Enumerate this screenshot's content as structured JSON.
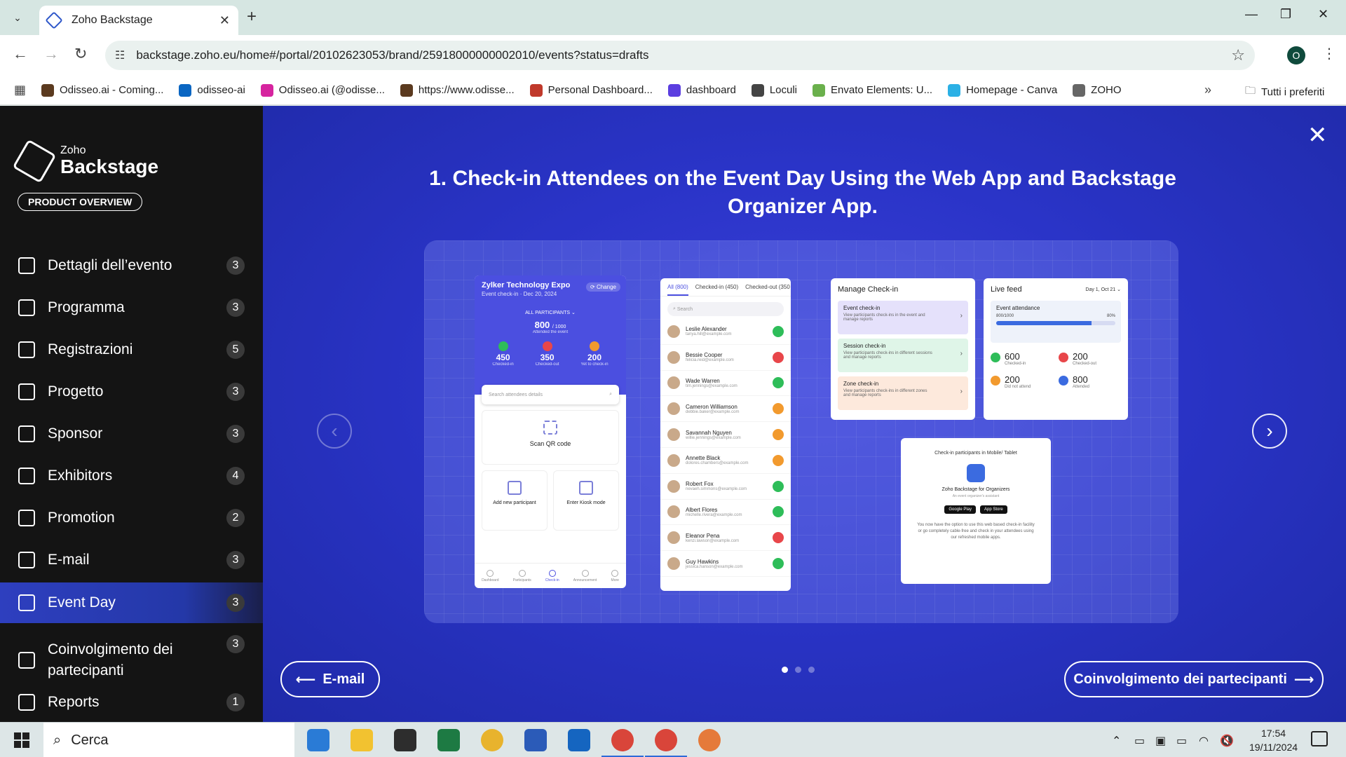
{
  "browser": {
    "tab_title": "Zoho Backstage",
    "url": "backstage.zoho.eu/home#/portal/20102623053/brand/25918000000002010/events?status=drafts",
    "profile_initial": "O",
    "bookmarks": [
      {
        "label": "Odisseo.ai - Coming...",
        "color": "#5b3a1f"
      },
      {
        "label": "odisseo-ai",
        "color": "#0a66c2"
      },
      {
        "label": "Odisseo.ai (@odisse...",
        "color": "#d6249f"
      },
      {
        "label": "https://www.odisse...",
        "color": "#5b3a1f"
      },
      {
        "label": "Personal Dashboard...",
        "color": "#c0392b"
      },
      {
        "label": "dashboard",
        "color": "#5b3ee0"
      },
      {
        "label": "Loculi",
        "color": "#444444"
      },
      {
        "label": "Envato Elements: U...",
        "color": "#6ab04c"
      },
      {
        "label": "Homepage - Canva",
        "color": "#2bb0e5"
      },
      {
        "label": "ZOHO",
        "color": "#666666"
      }
    ],
    "all_bookmarks": "Tutti i preferiti"
  },
  "sidebar": {
    "logo_small": "Zoho",
    "logo_big": "Backstage",
    "product_overview": "PRODUCT OVERVIEW",
    "items": [
      {
        "label": "Dettagli dell’evento",
        "count": "3"
      },
      {
        "label": "Programma",
        "count": "3"
      },
      {
        "label": "Registrazioni",
        "count": "5"
      },
      {
        "label": "Progetto",
        "count": "3"
      },
      {
        "label": "Sponsor",
        "count": "3"
      },
      {
        "label": "Exhibitors",
        "count": "4"
      },
      {
        "label": "Promotion",
        "count": "2"
      },
      {
        "label": "E-mail",
        "count": "3"
      },
      {
        "label": "Event Day",
        "count": "3"
      },
      {
        "label": "Coinvolgimento dei partecipanti",
        "count": "3"
      },
      {
        "label": "Reports",
        "count": "1"
      }
    ]
  },
  "main": {
    "headline": "1. Check-in Attendees on the Event Day Using the Web App and Backstage Organizer App.",
    "prev_label": "E-mail",
    "next_label": "Coinvolgimento dei partecipanti",
    "phone": {
      "title": "Zylker Technology Expo",
      "sub": "Event check-in · Dec 20, 2024",
      "change": "Change",
      "all": "ALL PARTICIPANTS",
      "count": "800",
      "count_total": "/ 1000",
      "attended": "Attended the event",
      "stats": [
        {
          "n": "450",
          "l": "Checked-in",
          "color": "#2ebd59"
        },
        {
          "n": "350",
          "l": "Checked-out",
          "color": "#e8464a"
        },
        {
          "n": "200",
          "l": "Yet to check-in",
          "color": "#f29a2e"
        }
      ],
      "search": "Search attendees details",
      "scan": "Scan QR code",
      "add": "Add new participant",
      "kiosk": "Enter Kiosk mode",
      "nav": [
        "Dashboard",
        "Participants",
        "Check-in",
        "Announcement",
        "More"
      ]
    },
    "list": {
      "tabs": [
        "All (800)",
        "Checked-in (450)",
        "Checked-out (350"
      ],
      "search": "Search",
      "rows": [
        {
          "name": "Leslie Alexander",
          "email": "tanya.hill@example.com",
          "color": "#2ebd59"
        },
        {
          "name": "Bessie Cooper",
          "email": "felicia.reid@example.com",
          "color": "#e8464a"
        },
        {
          "name": "Wade Warren",
          "email": "tim.jennings@example.com",
          "color": "#2ebd59"
        },
        {
          "name": "Cameron Williamson",
          "email": "debbie.baker@example.com",
          "color": "#f29a2e"
        },
        {
          "name": "Savannah Nguyen",
          "email": "willie.jennings@example.com",
          "color": "#f29a2e"
        },
        {
          "name": "Annette Black",
          "email": "dolores.chambers@example.com",
          "color": "#f29a2e"
        },
        {
          "name": "Robert Fox",
          "email": "nevaeh.simmons@example.com",
          "color": "#2ebd59"
        },
        {
          "name": "Albert Flores",
          "email": "michelle.rivera@example.com",
          "color": "#2ebd59"
        },
        {
          "name": "Eleanor Pena",
          "email": "kenzi.lawson@example.com",
          "color": "#e8464a"
        },
        {
          "name": "Guy Hawkins",
          "email": "jessica.hanson@example.com",
          "color": "#2ebd59"
        }
      ]
    },
    "manage": {
      "title": "Manage Check-in",
      "options": [
        {
          "t": "Event check-in",
          "d": "View participants check-ins in the event and manage reports",
          "color": "#e5e1fb"
        },
        {
          "t": "Session check-in",
          "d": "View participants check-ins in different sessions and manage reports",
          "color": "#dff5e8"
        },
        {
          "t": "Zone check-in",
          "d": "View participants check-ins in different zones and manage reports",
          "color": "#fde9dc"
        }
      ]
    },
    "live": {
      "title": "Live feed",
      "date": "Day 1, Oct 21",
      "att_label": "Event attendance",
      "att_value": "800/1000",
      "att_pct": "80%",
      "att_fraction": 0.8,
      "stats": [
        {
          "n": "600",
          "l": "Checked-in",
          "color": "#2ebd59"
        },
        {
          "n": "200",
          "l": "Checked-out",
          "color": "#e8464a"
        },
        {
          "n": "200",
          "l": "Did not attend",
          "color": "#f29a2e"
        },
        {
          "n": "800",
          "l": "Attended",
          "color": "#3b6be0"
        }
      ]
    },
    "mobile": {
      "header": "Check-in participants in Mobile/ Tablet",
      "app_name": "Zoho Backstage for Organizers",
      "app_sub": "An event organizer's assistant",
      "google": "Google Play",
      "apple": "App Store",
      "para": "You now have the option to use this web based check-in facility or go completely cable-free and check in your attendees using our refreshed mobile apps."
    }
  },
  "taskbar": {
    "search": "Cerca",
    "time": "17:54",
    "date": "19/11/2024"
  }
}
